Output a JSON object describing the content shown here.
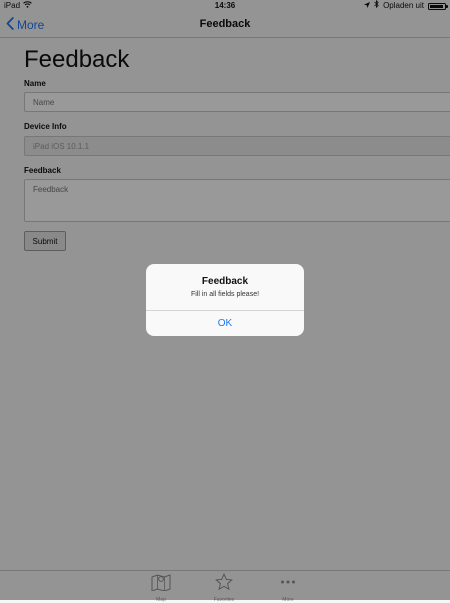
{
  "status_bar": {
    "device": "iPad",
    "time": "14:36",
    "charging_text": "Opladen uit",
    "battery_level": 0.92
  },
  "nav_bar": {
    "back_label": "More",
    "title": "Feedback"
  },
  "form": {
    "heading": "Feedback",
    "name_label": "Name",
    "name_placeholder": "Name",
    "device_info_label": "Device Info",
    "device_info_value": "iPad iOS 10.1.1",
    "feedback_label": "Feedback",
    "feedback_placeholder": "Feedback",
    "submit_label": "Submit"
  },
  "tab_bar": {
    "items": [
      {
        "label": "Map",
        "icon": "map-icon"
      },
      {
        "label": "Favorites",
        "icon": "star-icon"
      },
      {
        "label": "More",
        "icon": "more-icon"
      }
    ]
  },
  "alert": {
    "title": "Feedback",
    "message": "Fill in all fields please!",
    "button_label": "OK"
  },
  "colors": {
    "accent": "#1a78f5",
    "overlay": "rgba(0,0,0,0.40)"
  }
}
